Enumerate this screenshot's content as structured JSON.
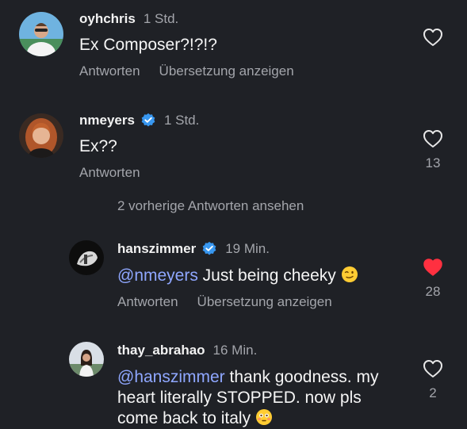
{
  "comments": [
    {
      "username": "oyhchris",
      "time": "1 Std.",
      "verified": false,
      "text": "Ex Composer?!?!?",
      "reply_label": "Antworten",
      "translate_label": "Übersetzung anzeigen",
      "likes": "",
      "liked": false
    },
    {
      "username": "nmeyers",
      "time": "1 Std.",
      "verified": true,
      "text": "Ex??",
      "reply_label": "Antworten",
      "likes": "13",
      "liked": false
    }
  ],
  "view_replies_label": "2 vorherige Antworten ansehen",
  "replies": [
    {
      "username": "hanszimmer",
      "time": "19 Min.",
      "verified": true,
      "mention": "@nmeyers",
      "text": " Just being cheeky ",
      "emoji": "winking-face-emoji",
      "reply_label": "Antworten",
      "translate_label": "Übersetzung anzeigen",
      "likes": "28",
      "liked": true
    },
    {
      "username": "thay_abrahao",
      "time": "16 Min.",
      "verified": false,
      "mention": "@hanszimmer",
      "text_line1": " thank goodness. my",
      "text_line2": "heart literally STOPPED. now pls",
      "text_line3": "come back to italy ",
      "emoji": "flushed-face-emoji",
      "likes": "2",
      "liked": false
    }
  ],
  "colors": {
    "background": "#1f2126",
    "secondary_text": "#a3a5ab",
    "mention": "#8fa7ff",
    "liked_heart": "#ff3040",
    "verified": "#3897f0"
  }
}
